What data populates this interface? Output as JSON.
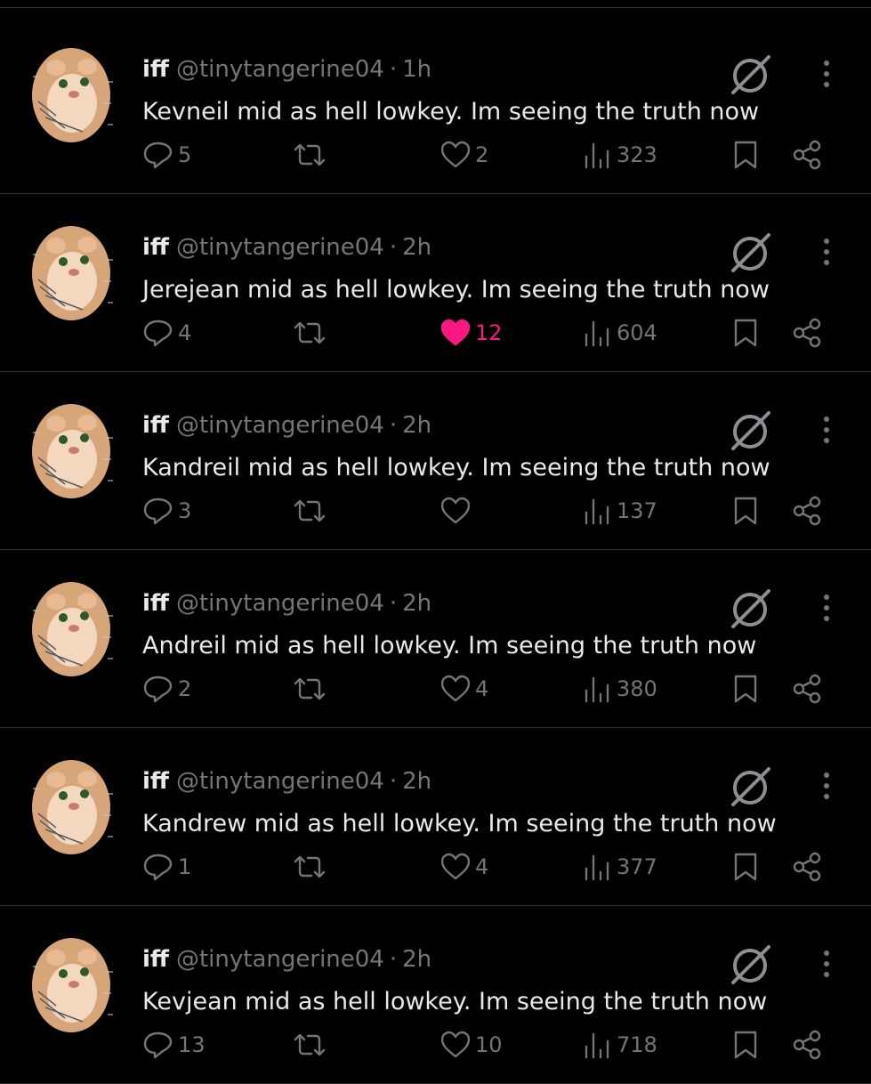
{
  "colors": {
    "background": "#000000",
    "text": "#e7e9ea",
    "muted": "#71767b",
    "divider": "#2f3336",
    "like_active": "#f91880"
  },
  "icons": {
    "reply": "reply-icon",
    "retweet": "retweet-icon",
    "like": "heart-icon",
    "views": "views-bar-chart-icon",
    "bookmark": "bookmark-icon",
    "share": "share-icon",
    "grok": "grok-icon",
    "more": "more-vertical-icon"
  },
  "posts": [
    {
      "name": "iff",
      "handle": "@tinytangerine04",
      "sep": "·",
      "time": "1h",
      "text": "Kevneil mid as hell lowkey. Im seeing the truth now",
      "replies": "5",
      "reposts": "",
      "likes": "2",
      "liked": false,
      "views": "323"
    },
    {
      "name": "iff",
      "handle": "@tinytangerine04",
      "sep": "·",
      "time": "2h",
      "text": "Jerejean mid as hell lowkey. Im seeing the truth now",
      "replies": "4",
      "reposts": "",
      "likes": "12",
      "liked": true,
      "views": "604"
    },
    {
      "name": "iff",
      "handle": "@tinytangerine04",
      "sep": "·",
      "time": "2h",
      "text": "Kandreil mid as hell lowkey. Im seeing the truth now",
      "replies": "3",
      "reposts": "",
      "likes": "",
      "liked": false,
      "views": "137"
    },
    {
      "name": "iff",
      "handle": "@tinytangerine04",
      "sep": "·",
      "time": "2h",
      "text": "Andreil mid as hell lowkey. Im seeing the truth now",
      "replies": "2",
      "reposts": "",
      "likes": "4",
      "liked": false,
      "views": "380"
    },
    {
      "name": "iff",
      "handle": "@tinytangerine04",
      "sep": "·",
      "time": "2h",
      "text": "Kandrew mid as hell lowkey. Im seeing the truth now",
      "replies": "1",
      "reposts": "",
      "likes": "4",
      "liked": false,
      "views": "377"
    },
    {
      "name": "iff",
      "handle": "@tinytangerine04",
      "sep": "·",
      "time": "2h",
      "text": "Kevjean mid as hell lowkey. Im seeing the truth now",
      "replies": "13",
      "reposts": "",
      "likes": "10",
      "liked": false,
      "views": "718"
    }
  ]
}
